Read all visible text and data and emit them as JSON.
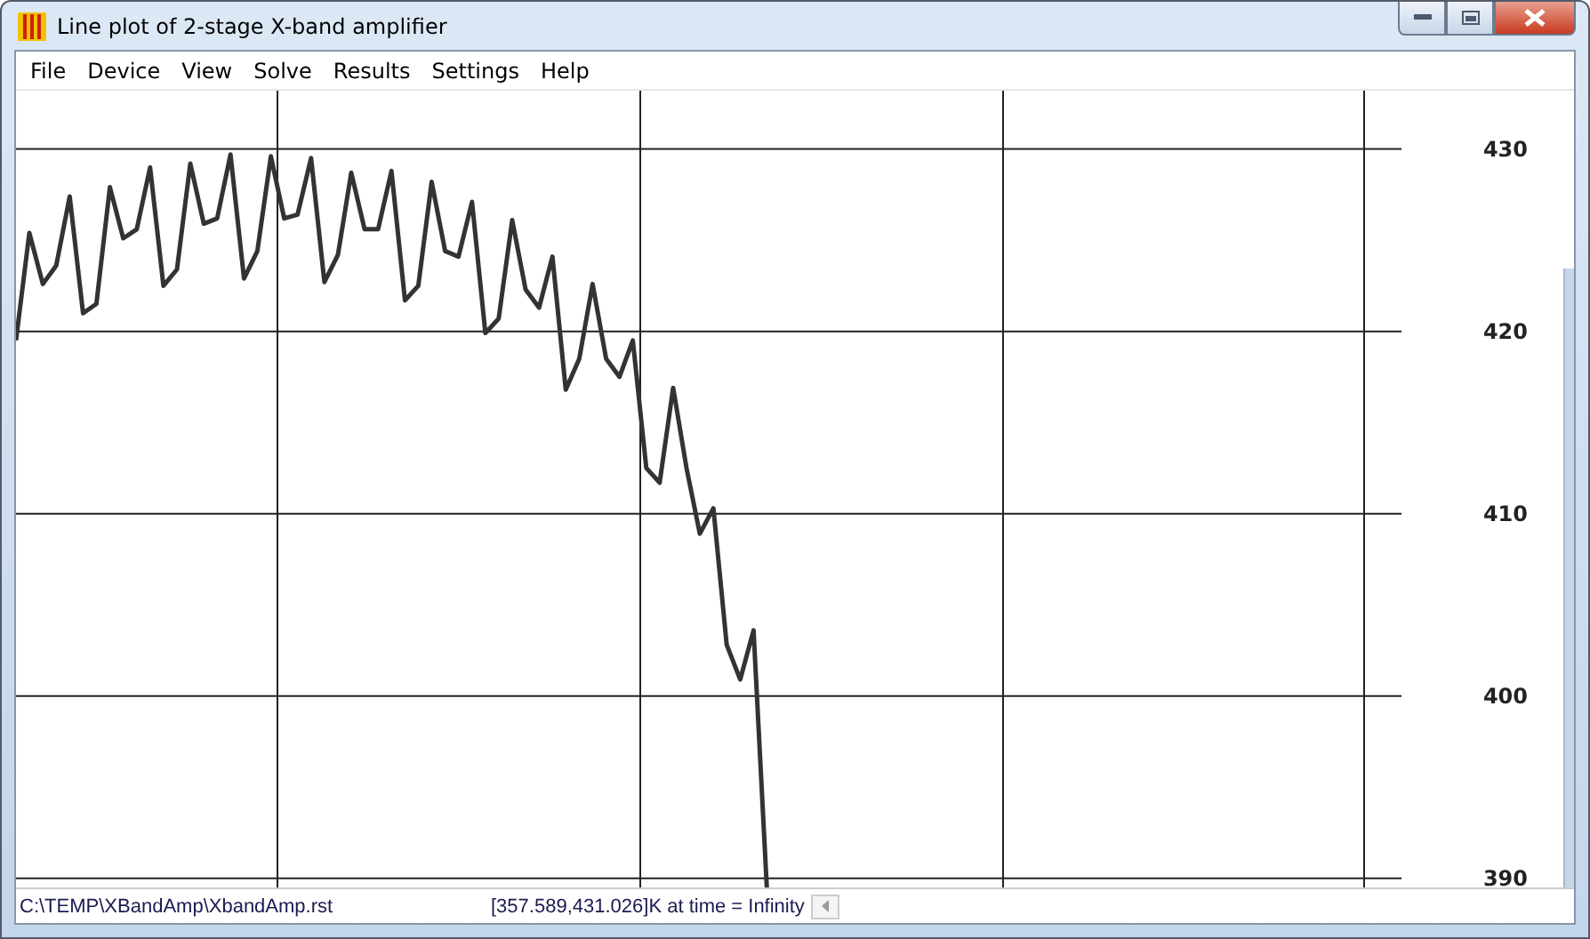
{
  "window": {
    "title": "Line plot of 2-stage X-band amplifier"
  },
  "menu": [
    "File",
    "Device",
    "View",
    "Solve",
    "Results",
    "Settings",
    "Help"
  ],
  "plot": {
    "chart_data": {
      "type": "line",
      "grid": true,
      "categories": [
        null,
        null,
        null,
        null,
        null,
        null,
        null,
        null,
        null,
        null,
        null,
        null,
        null,
        null,
        null,
        null,
        null,
        null,
        null,
        null,
        null,
        null,
        null,
        null,
        null,
        null,
        null,
        null,
        null,
        null,
        null,
        null,
        null,
        null,
        null,
        null,
        null,
        null,
        null,
        null,
        null,
        null,
        null,
        null,
        null,
        null,
        null,
        null,
        null,
        null,
        null,
        null,
        null,
        null,
        null,
        null,
        null
      ],
      "ylim": [
        389.4,
        433.2
      ],
      "yticks": [
        {
          "value": 390,
          "label": "390"
        },
        {
          "value": 400,
          "label": "400"
        },
        {
          "value": 410,
          "label": "410"
        },
        {
          "value": 420,
          "label": "420"
        },
        {
          "value": 430,
          "label": "430"
        }
      ],
      "series": [
        {
          "color": "#333333",
          "values": [
            419.5,
            425.4,
            422.6,
            423.6,
            427.4,
            421.0,
            421.5,
            427.9,
            425.1,
            425.6,
            429.0,
            422.5,
            423.4,
            429.2,
            425.9,
            426.2,
            429.7,
            422.9,
            424.4,
            429.6,
            426.2,
            426.4,
            429.5,
            422.7,
            424.2,
            428.7,
            425.6,
            425.6,
            428.8,
            421.7,
            422.5,
            428.2,
            424.4,
            424.1,
            427.1,
            419.9,
            420.7,
            426.1,
            422.3,
            421.3,
            424.1,
            416.8,
            418.5,
            422.6,
            418.5,
            417.5,
            419.5,
            412.5,
            411.7,
            416.9,
            412.5,
            408.9,
            410.3,
            402.8,
            400.9,
            403.6,
            389.4
          ]
        }
      ]
    }
  },
  "status_bar": {
    "file": "C:\\TEMP\\XBandAmp\\XbandAmp.rst",
    "reading": "[357.589,431.026]K at time = Infinity"
  }
}
